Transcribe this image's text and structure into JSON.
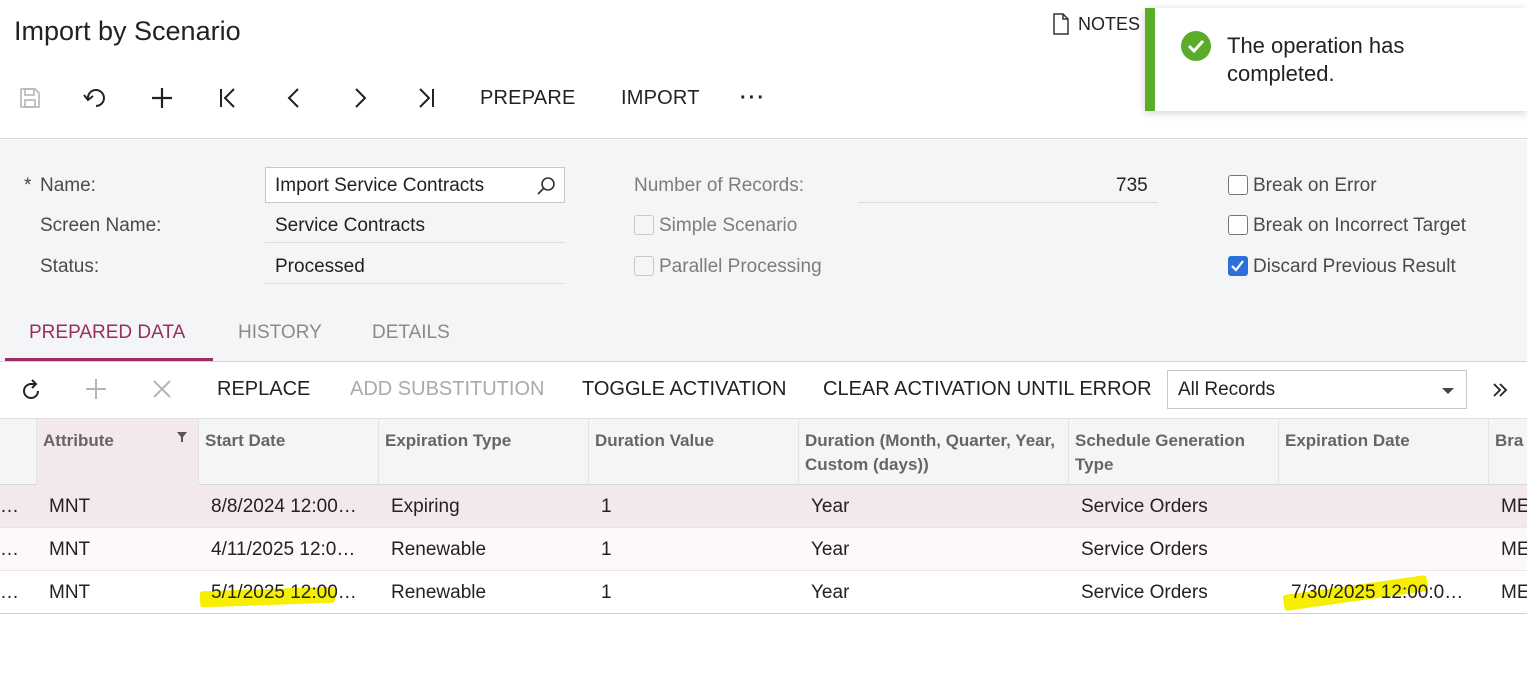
{
  "page": {
    "title": "Import by Scenario",
    "notes_label": "NOTES"
  },
  "toolbar": {
    "icons": [
      "save-icon",
      "undo-icon",
      "add-icon",
      "first-record-icon",
      "previous-icon",
      "next-icon",
      "last-record-icon"
    ],
    "prepare_label": "PREPARE",
    "import_label": "IMPORT",
    "more_label": "···"
  },
  "toast": {
    "message": "The operation has completed.",
    "color": "#5aac2a"
  },
  "form": {
    "name_label": "Name:",
    "name_value": "Import Service Contracts",
    "screen_label": "Screen Name:",
    "screen_value": "Service Contracts",
    "status_label": "Status:",
    "status_value": "Processed",
    "records_label": "Number of Records:",
    "records_value": "735",
    "simple_scenario_label": "Simple Scenario",
    "parallel_label": "Parallel Processing",
    "break_error_label": "Break on Error",
    "break_target_label": "Break on Incorrect Target",
    "discard_label": "Discard Previous Result",
    "required_mark": "*"
  },
  "tabs": [
    "PREPARED DATA",
    "HISTORY",
    "DETAILS"
  ],
  "gridbar": {
    "replace": "REPLACE",
    "add_substitution": "ADD SUBSTITUTION",
    "toggle_activation": "TOGGLE ACTIVATION",
    "clear_activation": "CLEAR ACTIVATION UNTIL ERROR",
    "filter_value": "All Records"
  },
  "grid": {
    "headers": [
      "Attribute",
      "Start Date",
      "Expiration Type",
      "Duration Value",
      "Duration (Month, Quarter, Year, Custom (days))",
      "Schedule Generation Type",
      "Expiration Date",
      "Bra"
    ],
    "rows": [
      [
        "MNT",
        "8/8/2024 12:00…",
        "Expiring",
        "1",
        "Year",
        "Service Orders",
        "",
        "ME"
      ],
      [
        "MNT",
        "4/11/2025 12:0…",
        "Renewable",
        "1",
        "Year",
        "Service Orders",
        "",
        "ME"
      ],
      [
        "MNT",
        "5/1/2025 12:00…",
        "Renewable",
        "1",
        "Year",
        "Service Orders",
        "7/30/2025 12:00:0…",
        "ME"
      ]
    ],
    "row_prefix": "…"
  },
  "colors": {
    "accent": "#9b2d63",
    "checkbox": "#2b6fd8",
    "selected_row": "#f3e8ec",
    "highlight": "#f7ef00"
  }
}
